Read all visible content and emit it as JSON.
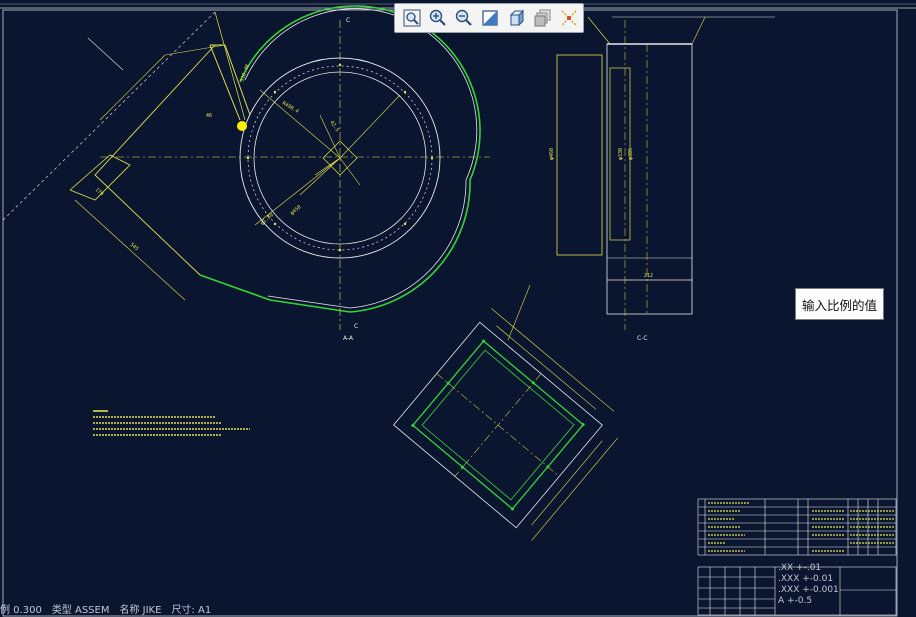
{
  "toolbar": {
    "buttons": [
      {
        "name": "zoom-fit-button",
        "icon": "zoom-fit-icon"
      },
      {
        "name": "zoom-in-button",
        "icon": "zoom-in-icon"
      },
      {
        "name": "zoom-out-button",
        "icon": "zoom-out-icon"
      },
      {
        "name": "display-style-button",
        "icon": "display-style-icon"
      },
      {
        "name": "view-orientation-button",
        "icon": "cube-view-icon"
      },
      {
        "name": "layers-button",
        "icon": "layers-icon"
      },
      {
        "name": "datum-display-button",
        "icon": "datum-display-icon"
      }
    ]
  },
  "tooltip": {
    "text": "输入比例的值"
  },
  "status": {
    "scale": "例 0.300",
    "type": "类型 ASSEM",
    "name": "名称 JIKE",
    "size": "尺寸: A1"
  },
  "tolerances": [
    ".XX +-.01",
    ".XXX +-0.01",
    ".XXX +-0.001",
    "A +-0.5"
  ],
  "drawing": {
    "section_labels": [
      "C",
      "C",
      "A-A",
      "C-C"
    ],
    "view_title_left": "A-A",
    "view_title_right": "C-C"
  },
  "colors": {
    "background": "#0a1530",
    "lines": "#e6e24a",
    "white_lines": "#e8e8e8",
    "green_lines": "#35d435"
  }
}
